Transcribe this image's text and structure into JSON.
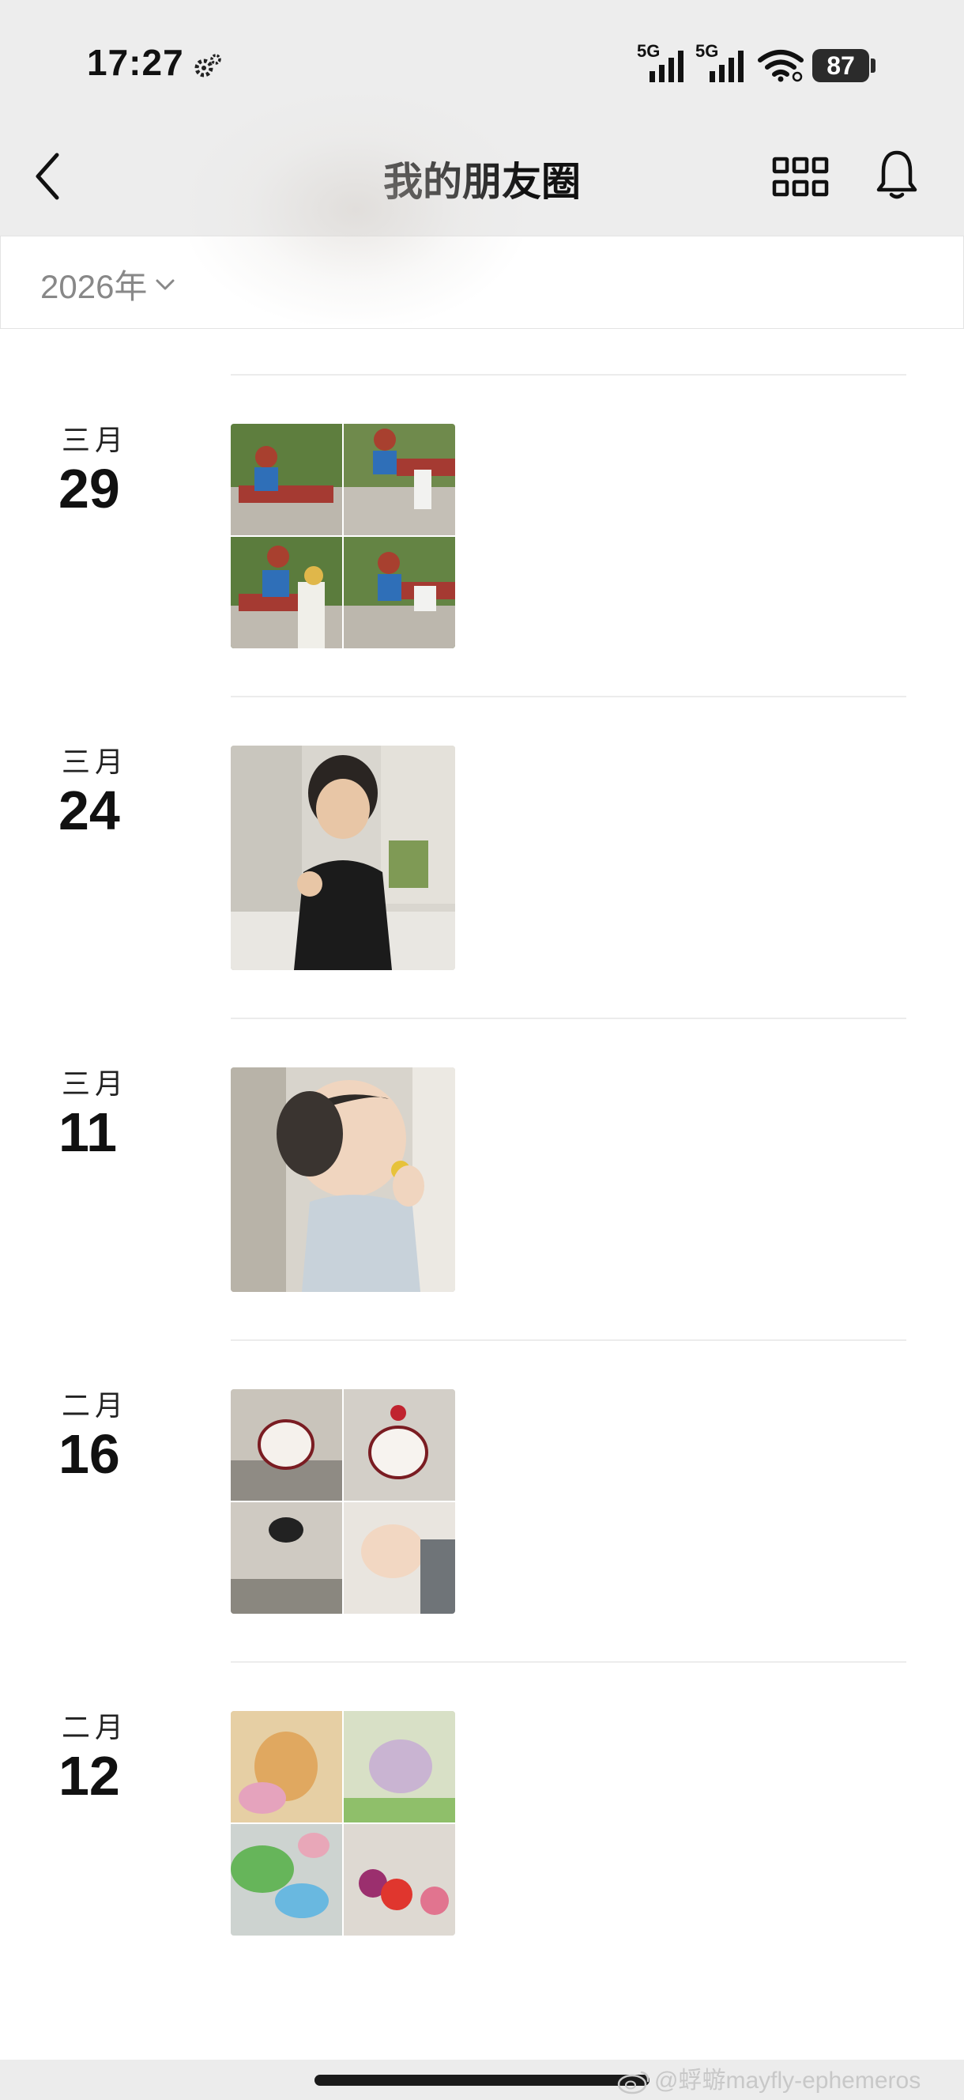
{
  "status_bar": {
    "time": "17:27",
    "battery": "87",
    "signal_1_label": "5G",
    "signal_2_label": "5G"
  },
  "header": {
    "title": "我的朋友圈"
  },
  "year_filter": {
    "value": "2026年"
  },
  "timeline": [
    {
      "month": "三月",
      "day": "29"
    },
    {
      "month": "三月",
      "day": "24"
    },
    {
      "month": "三月",
      "day": "11"
    },
    {
      "month": "二月",
      "day": "16"
    },
    {
      "month": "二月",
      "day": "12"
    }
  ],
  "watermark": {
    "text": "@蜉蝣mayfly-ephemeros"
  },
  "colors": {
    "header_bg": "#ededed",
    "divider": "#ececec",
    "year_text": "#888888"
  }
}
